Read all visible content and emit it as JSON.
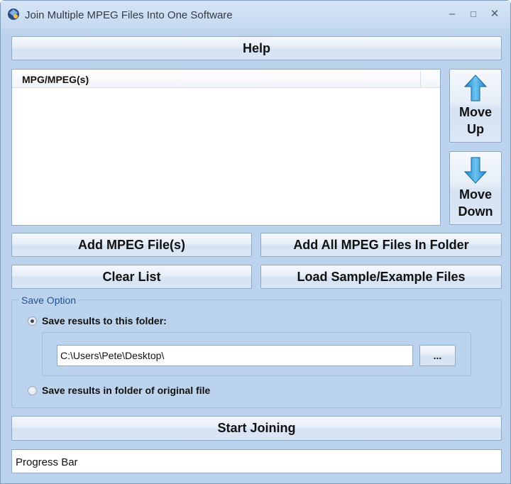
{
  "window": {
    "title": "Join Multiple MPEG Files Into One Software",
    "minimize_glyph": "–",
    "maximize_glyph": "□",
    "close_glyph": "✕"
  },
  "buttons": {
    "help": "Help",
    "move_up_line1": "Move",
    "move_up_line2": "Up",
    "move_down_line1": "Move",
    "move_down_line2": "Down",
    "add_files": "Add MPEG File(s)",
    "add_folder": "Add All MPEG Files In Folder",
    "clear_list": "Clear List",
    "load_sample": "Load Sample/Example Files",
    "browse": "...",
    "start": "Start Joining"
  },
  "file_list": {
    "column_header": "MPG/MPEG(s)",
    "items": []
  },
  "save_option": {
    "group_title": "Save Option",
    "option_folder_label": "Save results to this folder:",
    "option_folder_selected": true,
    "folder_path": "C:\\Users\\Pete\\Desktop\\",
    "option_original_label": "Save results in folder of original file",
    "option_original_selected": false
  },
  "progress": {
    "label": "Progress Bar"
  },
  "colors": {
    "window_bg": "#bcd3ee",
    "button_border": "#8fa9c8",
    "group_title": "#1f4f9a",
    "arrow_fill": "#3fa4df"
  }
}
